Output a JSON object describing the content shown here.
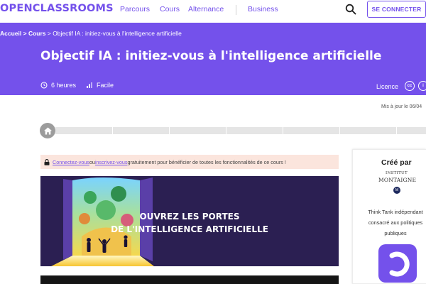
{
  "nav": {
    "logo": "OPENCLASSROOMS",
    "links": [
      "Parcours",
      "Cours",
      "Alternance",
      "Business"
    ],
    "login_label": "SE CONNECTER"
  },
  "breadcrumb": {
    "home": "Accueil",
    "sep1": " > ",
    "courses": "Cours",
    "sep2": " > ",
    "current": "Objectif IA : initiez-vous à l'intelligence artificielle"
  },
  "course": {
    "title": "Objectif IA : initiez-vous à l'intelligence artificielle",
    "duration": "6 heures",
    "level": "Facile",
    "licence_label": "Licence",
    "updated": "Mis à jour le 06/04"
  },
  "notice": {
    "login_link": "Connectez-vous",
    "or_text": " ou ",
    "signup_link": "inscrivez-vous",
    "rest": " gratuitement pour bénéficier de toutes les fonctionnalités de ce cours !"
  },
  "banner": {
    "line1": "OUVREZ LES PORTES",
    "line2": "DE L'INTELLIGENCE ARTIFICIELLE"
  },
  "sidebar": {
    "created_by": "Créé par",
    "inst_line1": "INSTITUT",
    "inst_line2": "MONTAIGNE",
    "badge": "M",
    "desc_line1": "Think Tank indépendant",
    "desc_line2": "consacré aux politiques",
    "desc_line3": "publiques"
  },
  "icons": [
    "search-icon",
    "clock-icon",
    "level-icon",
    "cc-icon",
    "home-icon",
    "lock-icon"
  ],
  "colors": {
    "brand": "#7451eb",
    "notice_bg": "#fbe5dd",
    "banner_bg": "#2b1f52"
  }
}
